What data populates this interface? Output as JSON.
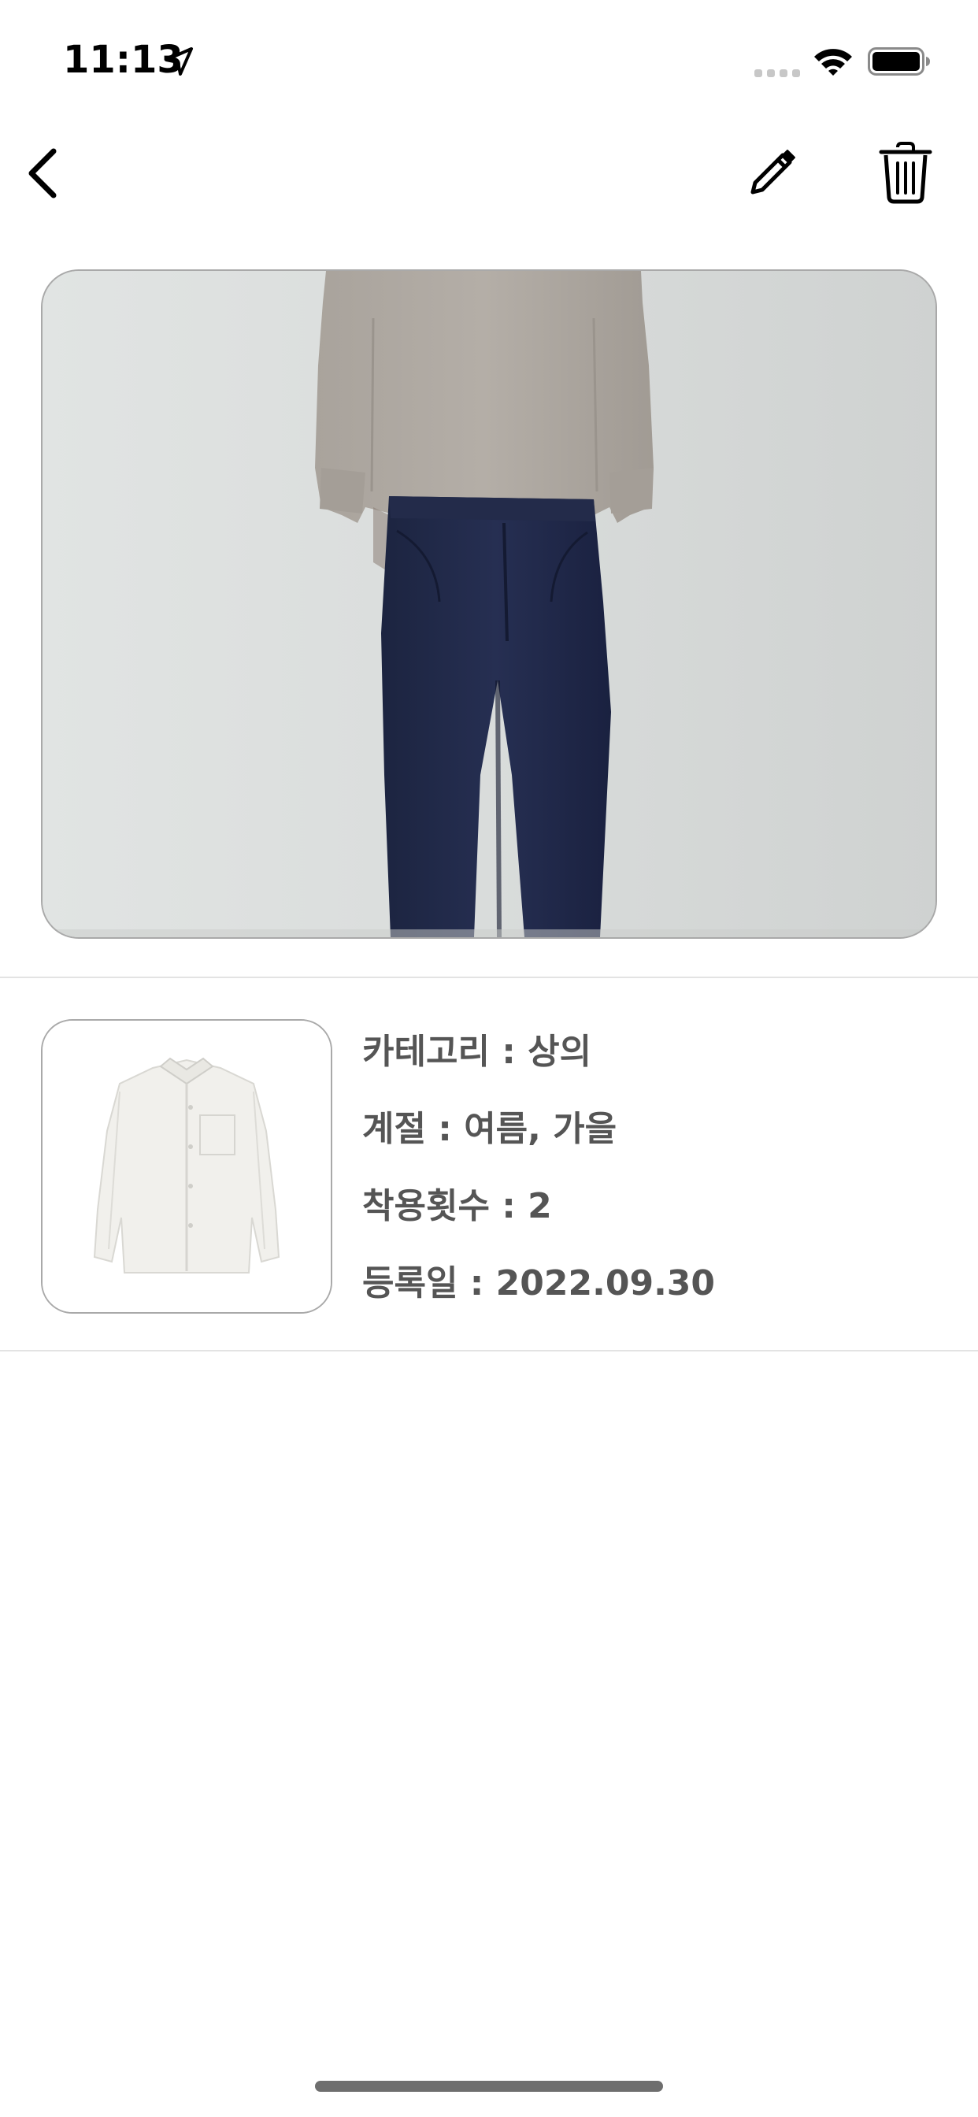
{
  "status_bar": {
    "time": "11:13",
    "icons": [
      "location-arrow-icon",
      "cellular-signal-icon",
      "wifi-icon",
      "battery-icon"
    ]
  },
  "nav": {
    "back_icon": "chevron-left-icon",
    "edit_icon": "pencil-icon",
    "delete_icon": "trash-icon"
  },
  "outfit_photo": {
    "description_icon": "outfit-photo"
  },
  "item": {
    "category": "카테고리 : 상의",
    "season": "계절 : 여름, 가을",
    "wear_count": "착용횟수 : 2",
    "registered_date": "등록일 : 2022.09.30"
  },
  "colors": {
    "text_primary": "#555555",
    "divider": "#e3e3e3",
    "border": "#a9a9a9",
    "home_indicator": "#6e6e6e"
  }
}
